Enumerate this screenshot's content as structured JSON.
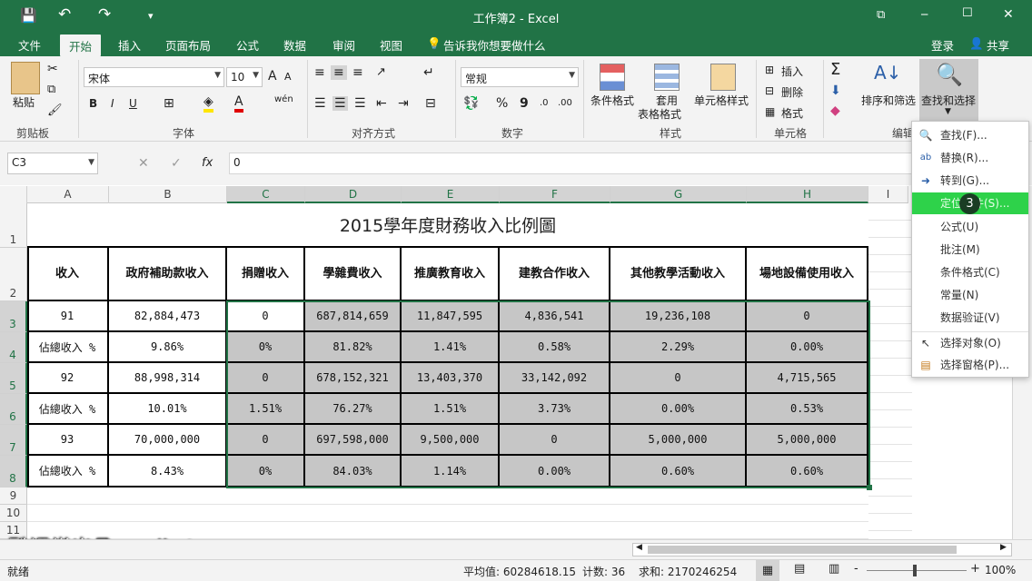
{
  "titlebar": {
    "title": "工作簿2 - Excel",
    "save_icon": "💾",
    "undo_icon": "↶",
    "redo_icon": "↷",
    "qa_icon": "▾",
    "restore_icon": "⧉",
    "min_icon": "─",
    "max_icon": "☐",
    "close_icon": "✕"
  },
  "tabs": {
    "file": "文件",
    "home": "开始",
    "insert": "插入",
    "layout": "页面布局",
    "formula": "公式",
    "data": "数据",
    "review": "审阅",
    "view": "视图",
    "tellme": "告诉我你想要做什么",
    "login": "登录",
    "share": "共享"
  },
  "ribbon": {
    "paste": "粘贴",
    "clipboard": "剪贴板",
    "font_name": "宋体",
    "font_size": "10",
    "grow": "A",
    "shrink": "A",
    "bold": "B",
    "italic": "I",
    "underline": "U",
    "wen": "wén",
    "font_group": "字体",
    "align_group": "对齐方式",
    "number_format": "常规",
    "percent": "%",
    "comma": "9",
    "number_group": "数字",
    "cond_format": "条件格式",
    "table_format_1": "套用",
    "table_format_2": "表格格式",
    "cell_style": "单元格样式",
    "style_group": "样式",
    "insert_cells": "插入",
    "delete_cells": "删除",
    "format_cells": "格式",
    "cells_group": "单元格",
    "sort_filter": "排序和筛选",
    "find_select": "查找和选择",
    "edit_group": "编辑"
  },
  "formula_bar": {
    "name_box": "C3",
    "cancel": "✕",
    "enter": "✓",
    "fx": "fx",
    "value": "0"
  },
  "sheet": {
    "columns": [
      "A",
      "B",
      "C",
      "D",
      "E",
      "F",
      "G",
      "H",
      "I"
    ],
    "rows": [
      "1",
      "2",
      "3",
      "4",
      "5",
      "6",
      "7",
      "8",
      "9",
      "10",
      "11"
    ],
    "title": "2015學年度財務收入比例圖",
    "headers": [
      "收入",
      "政府補助款收入",
      "捐贈收入",
      "學雜費收入",
      "推廣教育收入",
      "建教合作收入",
      "其他教學活動收入",
      "場地設備使用收入"
    ],
    "data": [
      [
        "91",
        "82,884,473",
        "0",
        "687,814,659",
        "11,847,595",
        "4,836,541",
        "19,236,108",
        "0"
      ],
      [
        "佔總收入 %",
        "9.86%",
        "0%",
        "81.82%",
        "1.41%",
        "0.58%",
        "2.29%",
        "0.00%"
      ],
      [
        "92",
        "88,998,314",
        "0",
        "678,152,321",
        "13,403,370",
        "33,142,092",
        "0",
        "4,715,565"
      ],
      [
        "佔總收入 %",
        "10.01%",
        "1.51%",
        "76.27%",
        "1.51%",
        "3.73%",
        "0.00%",
        "0.53%"
      ],
      [
        "93",
        "70,000,000",
        "0",
        "697,598,000",
        "9,500,000",
        "0",
        "5,000,000",
        "5,000,000"
      ],
      [
        "佔總收入 %",
        "8.43%",
        "0%",
        "84.03%",
        "1.14%",
        "0.00%",
        "0.60%",
        "0.60%"
      ]
    ]
  },
  "menu": {
    "items": [
      {
        "icon": "🔍",
        "label": "查找(F)..."
      },
      {
        "icon": "ab",
        "label": "替换(R)..."
      },
      {
        "icon": "➜",
        "label": "转到(G)..."
      },
      {
        "icon": "",
        "label": "定位条件(S)..."
      },
      {
        "icon": "",
        "label": "公式(U)"
      },
      {
        "icon": "",
        "label": "批注(M)"
      },
      {
        "icon": "",
        "label": "条件格式(C)"
      },
      {
        "icon": "",
        "label": "常量(N)"
      },
      {
        "icon": "",
        "label": "数据验证(V)"
      },
      {
        "icon": "↖",
        "label": "选择对象(O)"
      },
      {
        "icon": "▤",
        "label": "选择窗格(P)..."
      }
    ],
    "badge": "3"
  },
  "watermark": "酷课堂出品 coolketang.com",
  "status": {
    "ready": "就绪",
    "average": "平均值: 60284618.15",
    "count": "计数: 36",
    "sum": "求和: 2170246254",
    "zoom": "100%",
    "zoom_minus": "-",
    "zoom_plus": "+"
  },
  "colors": {
    "excel_green": "#217346",
    "menu_highlight": "#2ed24a",
    "cell_gray": "#c6c6c6"
  }
}
